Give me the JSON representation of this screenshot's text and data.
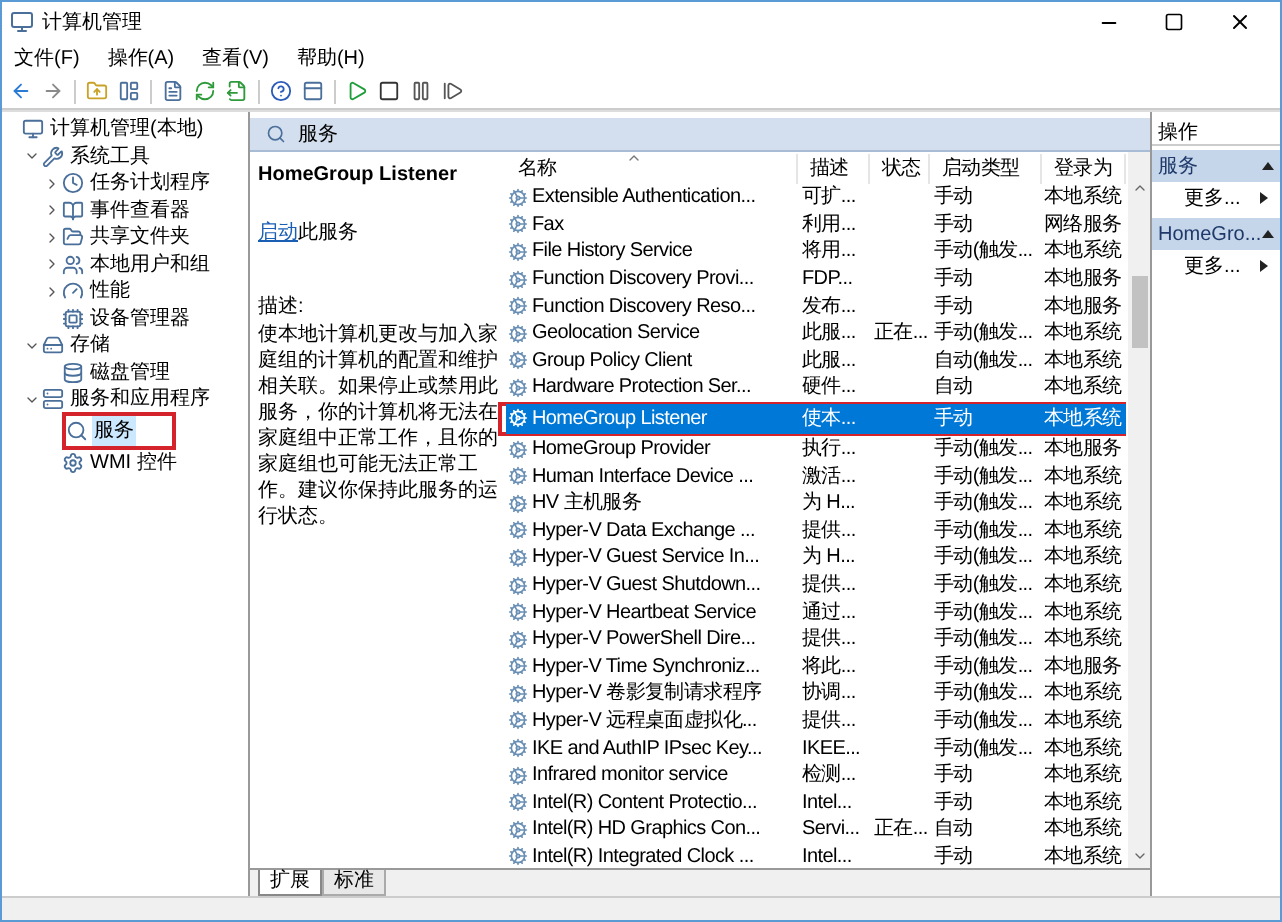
{
  "window": {
    "title": "计算机管理"
  },
  "menu": [
    "文件(F)",
    "操作(A)",
    "查看(V)",
    "帮助(H)"
  ],
  "tree": [
    {
      "label": "计算机管理(本地)",
      "selected": false,
      "annotated": false,
      "children": [
        {
          "label": "系统工具",
          "expanded": true,
          "selected": false,
          "annotated": false,
          "children": [
            {
              "label": "任务计划程序",
              "expanded": false,
              "selected": false,
              "annotated": false
            },
            {
              "label": "事件查看器",
              "expanded": false,
              "selected": false,
              "annotated": false
            },
            {
              "label": "共享文件夹",
              "expanded": false,
              "selected": false,
              "annotated": false
            },
            {
              "label": "本地用户和组",
              "expanded": false,
              "selected": false,
              "annotated": false
            },
            {
              "label": "性能",
              "expanded": false,
              "selected": false,
              "annotated": false
            },
            {
              "label": "设备管理器",
              "selected": false,
              "annotated": false
            }
          ]
        },
        {
          "label": "存储",
          "expanded": true,
          "selected": false,
          "annotated": false,
          "children": [
            {
              "label": "磁盘管理",
              "selected": false,
              "annotated": false
            }
          ]
        },
        {
          "label": "服务和应用程序",
          "expanded": true,
          "selected": false,
          "annotated": false,
          "children": [
            {
              "label": "服务",
              "selected": true,
              "annotated": true
            },
            {
              "label": "WMI 控件",
              "selected": false,
              "annotated": false
            }
          ]
        }
      ]
    }
  ],
  "panel": {
    "title": "服务",
    "service_name": "HomeGroup Listener",
    "start_link": "启动",
    "start_suffix": "此服务",
    "description_label": "描述:",
    "description": "使本地计算机更改与加入家庭组的计算机的配置和维护相关联。如果停止或禁用此服务，你的计算机将无法在家庭组中正常工作，且你的家庭组也可能无法正常工作。建议你保持此服务的运行状态。"
  },
  "table": {
    "columns": [
      "名称",
      "描述",
      "状态",
      "启动类型",
      "登录为"
    ],
    "rows": [
      {
        "name": "Extensible Authentication...",
        "desc": "可扩...",
        "startup": "手动",
        "logon": "本地系统",
        "selected": false,
        "annotated": false
      },
      {
        "name": "Fax",
        "desc": "利用...",
        "startup": "手动",
        "logon": "网络服务",
        "selected": false,
        "annotated": false
      },
      {
        "name": "File History Service",
        "desc": "将用...",
        "startup": "手动(触发...",
        "logon": "本地系统",
        "selected": false,
        "annotated": false
      },
      {
        "name": "Function Discovery Provi...",
        "desc": "FDP...",
        "startup": "手动",
        "logon": "本地服务",
        "selected": false,
        "annotated": false
      },
      {
        "name": "Function Discovery Reso...",
        "desc": "发布...",
        "startup": "手动",
        "logon": "本地服务",
        "selected": false,
        "annotated": false
      },
      {
        "name": "Geolocation Service",
        "desc": "此服...",
        "status": "正在...",
        "startup": "手动(触发...",
        "logon": "本地系统",
        "selected": false,
        "annotated": false
      },
      {
        "name": "Group Policy Client",
        "desc": "此服...",
        "startup": "自动(触发...",
        "logon": "本地系统",
        "selected": false,
        "annotated": false
      },
      {
        "name": "Hardware Protection Ser...",
        "desc": "硬件...",
        "startup": "自动",
        "logon": "本地系统",
        "selected": false,
        "annotated": false
      },
      {
        "name": "HomeGroup Listener",
        "desc": "使本...",
        "startup": "手动",
        "logon": "本地系统",
        "selected": true,
        "annotated": true
      },
      {
        "name": "HomeGroup Provider",
        "desc": "执行...",
        "startup": "手动(触发...",
        "logon": "本地服务",
        "selected": false,
        "annotated": false
      },
      {
        "name": "Human Interface Device ...",
        "desc": "激活...",
        "startup": "手动(触发...",
        "logon": "本地系统",
        "selected": false,
        "annotated": false
      },
      {
        "name": "HV 主机服务",
        "desc": "为 H...",
        "startup": "手动(触发...",
        "logon": "本地系统",
        "selected": false,
        "annotated": false
      },
      {
        "name": "Hyper-V Data Exchange ...",
        "desc": "提供...",
        "startup": "手动(触发...",
        "logon": "本地系统",
        "selected": false,
        "annotated": false
      },
      {
        "name": "Hyper-V Guest Service In...",
        "desc": "为 H...",
        "startup": "手动(触发...",
        "logon": "本地系统",
        "selected": false,
        "annotated": false
      },
      {
        "name": "Hyper-V Guest Shutdown...",
        "desc": "提供...",
        "startup": "手动(触发...",
        "logon": "本地系统",
        "selected": false,
        "annotated": false
      },
      {
        "name": "Hyper-V Heartbeat Service",
        "desc": "通过...",
        "startup": "手动(触发...",
        "logon": "本地系统",
        "selected": false,
        "annotated": false
      },
      {
        "name": "Hyper-V PowerShell Dire...",
        "desc": "提供...",
        "startup": "手动(触发...",
        "logon": "本地系统",
        "selected": false,
        "annotated": false
      },
      {
        "name": "Hyper-V Time Synchroniz...",
        "desc": "将此...",
        "startup": "手动(触发...",
        "logon": "本地服务",
        "selected": false,
        "annotated": false
      },
      {
        "name": "Hyper-V 卷影复制请求程序",
        "desc": "协调...",
        "startup": "手动(触发...",
        "logon": "本地系统",
        "selected": false,
        "annotated": false
      },
      {
        "name": "Hyper-V 远程桌面虚拟化...",
        "desc": "提供...",
        "startup": "手动(触发...",
        "logon": "本地系统",
        "selected": false,
        "annotated": false
      },
      {
        "name": "IKE and AuthIP IPsec Key...",
        "desc": "IKEE...",
        "startup": "手动(触发...",
        "logon": "本地系统",
        "selected": false,
        "annotated": false
      },
      {
        "name": "Infrared monitor service",
        "desc": "检测...",
        "startup": "手动",
        "logon": "本地系统",
        "selected": false,
        "annotated": false
      },
      {
        "name": "Intel(R) Content Protectio...",
        "desc": "Intel...",
        "startup": "手动",
        "logon": "本地系统",
        "selected": false,
        "annotated": false
      },
      {
        "name": "Intel(R) HD Graphics Con...",
        "desc": "Servi...",
        "status": "正在...",
        "startup": "自动",
        "logon": "本地系统",
        "selected": false,
        "annotated": false
      },
      {
        "name": "Intel(R) Integrated Clock ...",
        "desc": "Intel...",
        "startup": "手动",
        "logon": "本地系统",
        "selected": false,
        "annotated": false
      }
    ]
  },
  "bottom_tabs": [
    {
      "label": "扩展",
      "selected": true
    },
    {
      "label": "标准",
      "selected": false
    }
  ],
  "actions": {
    "title": "操作",
    "sections": [
      {
        "label": "服务",
        "items": [
          "更多..."
        ]
      },
      {
        "label": "HomeGro...",
        "items": [
          "更多..."
        ]
      }
    ]
  }
}
